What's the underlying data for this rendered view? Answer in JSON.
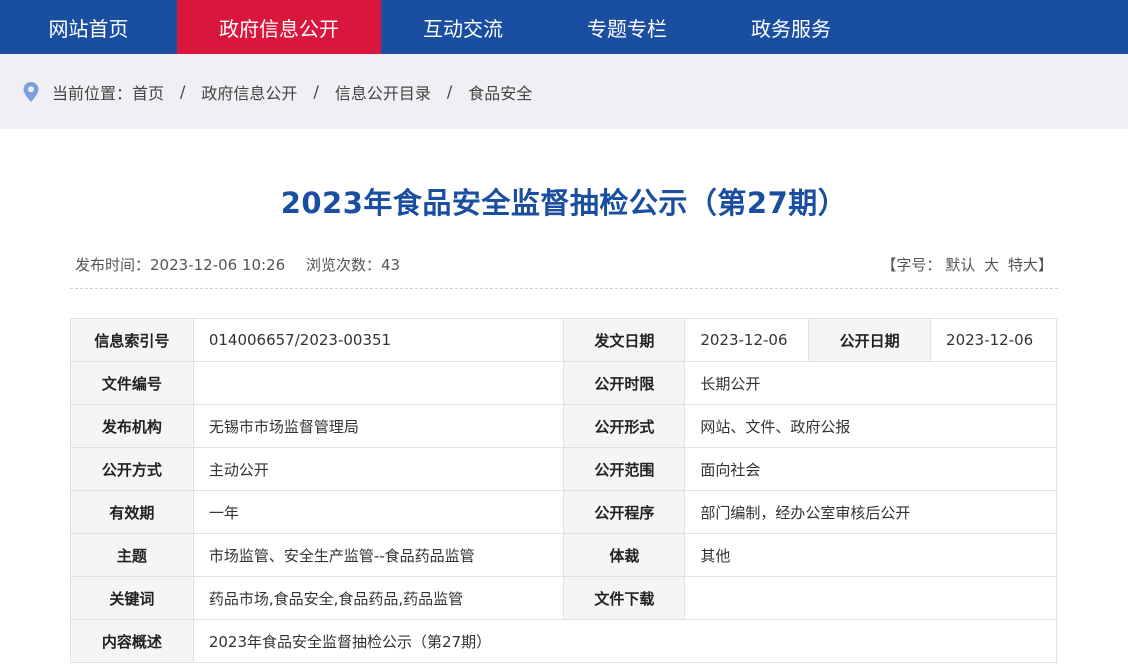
{
  "nav": {
    "items": [
      {
        "label": "网站首页"
      },
      {
        "label": "政府信息公开"
      },
      {
        "label": "互动交流"
      },
      {
        "label": "专题专栏"
      },
      {
        "label": "政务服务"
      }
    ],
    "active_index": 1
  },
  "breadcrumb": {
    "prefix": "当前位置：",
    "items": [
      "首页",
      "政府信息公开",
      "信息公开目录",
      "食品安全"
    ],
    "separator": "/"
  },
  "article": {
    "title": "2023年食品安全监督抽检公示（第27期）",
    "publish_time": "发布时间：2023-12-06 10:26",
    "views": "浏览次数：43",
    "font_size_prefix": "【字号：",
    "font_size_options": [
      "默认",
      "大",
      "特大"
    ],
    "font_size_suffix": "】"
  },
  "info_table": {
    "index_no_label": "信息索引号",
    "index_no": "014006657/2023-00351",
    "issue_date_label": "发文日期",
    "issue_date": "2023-12-06",
    "open_date_label": "公开日期",
    "open_date": "2023-12-06",
    "doc_no_label": "文件编号",
    "doc_no": "",
    "open_period_label": "公开时限",
    "open_period": "长期公开",
    "publisher_label": "发布机构",
    "publisher": "无锡市市场监督管理局",
    "open_form_label": "公开形式",
    "open_form": "网站、文件、政府公报",
    "open_method_label": "公开方式",
    "open_method": "主动公开",
    "open_scope_label": "公开范围",
    "open_scope": "面向社会",
    "validity_label": "有效期",
    "validity": "一年",
    "open_procedure_label": "公开程序",
    "open_procedure": "部门编制，经办公室审核后公开",
    "topic_label": "主题",
    "topic": "市场监管、安全生产监管--食品药品监管",
    "genre_label": "体裁",
    "genre": "其他",
    "keywords_label": "关键词",
    "keywords": "药品市场,食品安全,食品药品,药品监管",
    "download_label": "文件下载",
    "download": "",
    "summary_label": "内容概述",
    "summary": "2023年食品安全监督抽检公示（第27期）"
  }
}
